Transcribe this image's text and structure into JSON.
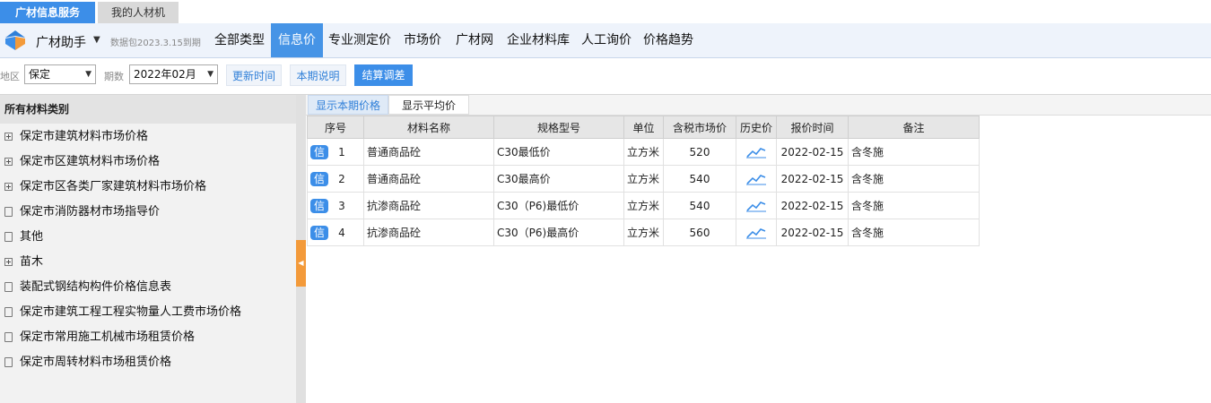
{
  "top_tabs": {
    "active": "广材信息服务",
    "inactive": "我的人材机"
  },
  "nav": {
    "app_name": "广材助手",
    "data_package": "数据包2023.3.15到期",
    "items": [
      "全部类型",
      "信息价",
      "专业测定价",
      "市场价",
      "广材网",
      "企业材料库",
      "人工询价",
      "价格趋势"
    ],
    "active_index": 1
  },
  "filter": {
    "region_label": "地区",
    "region_value": "保定",
    "period_label": "期数",
    "period_value": "2022年02月",
    "buttons": [
      "更新时间",
      "本期说明",
      "结算调差"
    ]
  },
  "left_panel": {
    "header": "所有材料类别",
    "items": [
      {
        "label": "保定市建筑材料市场价格",
        "icon": "expand-icon"
      },
      {
        "label": "保定市区建筑材料市场价格",
        "icon": "expand-icon"
      },
      {
        "label": "保定市区各类厂家建筑材料市场价格",
        "icon": "expand-icon"
      },
      {
        "label": "保定市消防器材市场指导价",
        "icon": "document-icon"
      },
      {
        "label": "其他",
        "icon": "document-icon"
      },
      {
        "label": "苗木",
        "icon": "expand-icon"
      },
      {
        "label": "装配式钢结构构件价格信息表",
        "icon": "document-icon"
      },
      {
        "label": "保定市建筑工程工程实物量人工费市场价格",
        "icon": "document-icon"
      },
      {
        "label": "保定市常用施工机械市场租赁价格",
        "icon": "document-icon"
      },
      {
        "label": "保定市周转材料市场租赁价格",
        "icon": "document-icon"
      }
    ]
  },
  "sub_tabs": {
    "active": "显示本期价格",
    "inactive": "显示平均价"
  },
  "table": {
    "headers": [
      "序号",
      "材料名称",
      "规格型号",
      "单位",
      "含税市场价",
      "历史价",
      "报价时间",
      "备注"
    ],
    "badge": "信",
    "rows": [
      {
        "no": "1",
        "name": "普通商品砼",
        "spec": "C30最低价",
        "unit": "立方米",
        "price": "520",
        "date": "2022-02-15",
        "note": "含冬施"
      },
      {
        "no": "2",
        "name": "普通商品砼",
        "spec": "C30最高价",
        "unit": "立方米",
        "price": "540",
        "date": "2022-02-15",
        "note": "含冬施"
      },
      {
        "no": "3",
        "name": "抗渗商品砼",
        "spec": "C30（P6)最低价",
        "unit": "立方米",
        "price": "540",
        "date": "2022-02-15",
        "note": "含冬施"
      },
      {
        "no": "4",
        "name": "抗渗商品砼",
        "spec": "C30（P6)最高价",
        "unit": "立方米",
        "price": "560",
        "date": "2022-02-15",
        "note": "含冬施"
      }
    ]
  },
  "colors": {
    "accent": "#3c8ee8",
    "handle": "#f39a3a"
  }
}
